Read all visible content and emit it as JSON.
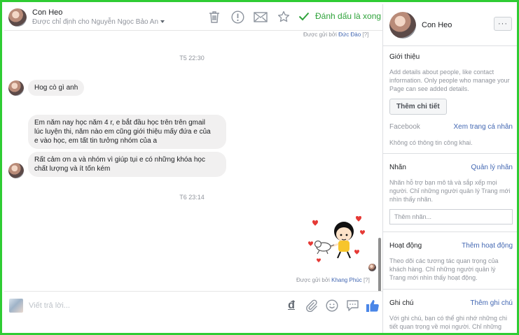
{
  "header": {
    "name": "Con Heo",
    "assigned": "Được chỉ định cho Nguyễn Ngọc Bảo An",
    "done_label": "Đánh dấu là xong"
  },
  "messages": {
    "sent_by_top": {
      "prefix": "Được gửi bởi",
      "name": "Đức Đào",
      "help": "[?]"
    },
    "time_1": "T5 22:30",
    "msg_1": "Hog cò gì anh",
    "msg_2_lines": [
      "Em năm nay học năm 4 r, e bắt đầu học trên trên gmail",
      "lúc luyện thi, năm nào em cũng giới thiệu mấy đứa e của",
      "e vào học, em tất tin tưởng  nhóm của a"
    ],
    "msg_3_lines": [
      "Rất cảm ơn a và nhóm vì giúp tụi e có những khóa học",
      "chất lượng và ít tốn kém"
    ],
    "time_2": "T6 23:14",
    "sent_by_bottom": {
      "prefix": "Được gửi bởi",
      "name": "Khang Phúc",
      "help": "[?]"
    }
  },
  "composer": {
    "placeholder": "Viết trả lời...",
    "currency_symbol": "đ"
  },
  "panel": {
    "name": "Con Heo",
    "more": "···",
    "intro": {
      "title": "Giới thiệu",
      "help": "Add details about people, like contact information. Only people who manage your Page can see added details.",
      "button": "Thêm chi tiết",
      "facebook_label": "Facebook",
      "facebook_link": "Xem trang cá nhân",
      "no_public": "Không có thông tin công khai."
    },
    "labels": {
      "title": "Nhãn",
      "link": "Quản lý nhãn",
      "help": "Nhãn hỗ trợ bạn mô tả và sắp xếp mọi người. Chỉ những người quản lý Trang mới nhìn thấy nhãn.",
      "placeholder": "Thêm nhãn..."
    },
    "activity": {
      "title": "Hoạt động",
      "link": "Thêm hoạt động",
      "help": "Theo dõi các tương tác quan trọng của khách hàng. Chỉ những người quản lý Trang mới nhìn thấy hoạt động."
    },
    "notes": {
      "title": "Ghi chú",
      "link": "Thêm ghi chú",
      "help": "Với ghi chú, bạn có thể ghi nhớ những chi tiết quan trọng về mọi người. Chỉ những"
    }
  },
  "colors": {
    "frame": "#2fcc33",
    "done_green": "#2fa33b",
    "link_blue": "#4267b2",
    "bubble_gray": "#f1f0f0",
    "like_blue": "#4a86e8"
  },
  "icons": {
    "header": [
      "trash-icon",
      "exclamation-icon",
      "envelope-icon",
      "star-icon",
      "checkmark-icon"
    ],
    "composer": [
      "dong-currency-icon",
      "paperclip-icon",
      "smiley-icon",
      "chat-bubble-icon",
      "thumbs-up-icon"
    ]
  }
}
